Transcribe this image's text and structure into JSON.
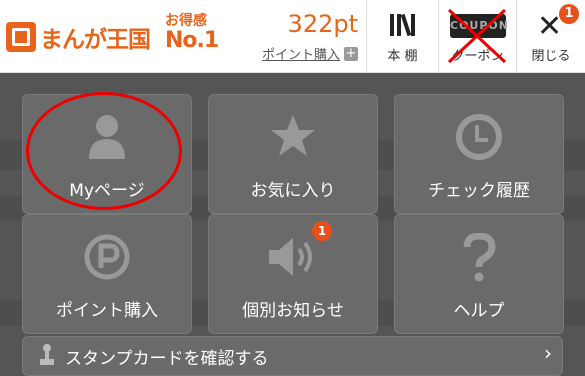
{
  "header": {
    "logo_text": "まんが王国",
    "badge_small": "お得感",
    "badge_big": "No.1",
    "points_value": "322pt",
    "buy_points_label": "ポイント購入",
    "buy_points_plus": "+",
    "shelf_label": "本 棚",
    "coupon_label": "クーポン",
    "coupon_icon_text": "COUPON",
    "close_label": "閉じる",
    "close_badge": "1"
  },
  "menu": {
    "tiles": [
      {
        "label": "Myページ",
        "icon": "person-icon"
      },
      {
        "label": "お気に入り",
        "icon": "star-icon"
      },
      {
        "label": "チェック履歴",
        "icon": "clock-icon"
      },
      {
        "label": "ポイント購入",
        "icon": "coin-p-icon"
      },
      {
        "label": "個別お知らせ",
        "icon": "speaker-icon",
        "badge": "1"
      },
      {
        "label": "ヘルプ",
        "icon": "question-icon"
      }
    ],
    "stamp_card_label": "スタンプカードを確認する",
    "stamp_card_chevron": "›"
  },
  "colors": {
    "brand": "#e8641b",
    "badge": "#e8501b",
    "tile": "#6a6a6a",
    "overlay": "#555555",
    "annotation": "#e00000"
  }
}
